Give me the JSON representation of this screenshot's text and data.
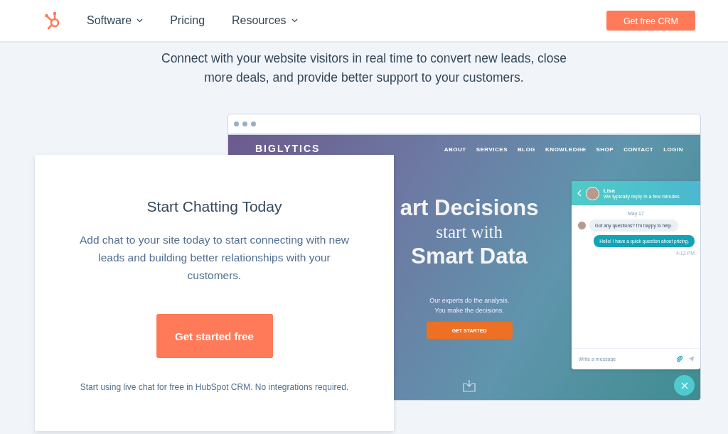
{
  "header": {
    "nav": [
      {
        "label": "Software",
        "dropdown": true
      },
      {
        "label": "Pricing",
        "dropdown": false
      },
      {
        "label": "Resources",
        "dropdown": true
      }
    ],
    "cta": "Get free CRM"
  },
  "intro": "Connect with your website visitors in real time to convert new leads, close more deals, and provide better support to your customers.",
  "mockup": {
    "site": {
      "logo": "BIGLYTICS",
      "nav": [
        "ABOUT",
        "SERVICES",
        "BLOG",
        "KNOWLEDGE",
        "SHOP",
        "CONTACT",
        "LOGIN"
      ],
      "headline": [
        "art Decisions",
        "start with",
        "Smart Data"
      ],
      "tagline": [
        "Our experts do the analysis.",
        "You make the decisions."
      ],
      "button": "GET STARTED"
    },
    "chat": {
      "agent": "Lisa",
      "status": "We typically reply in a few minutes",
      "date": "May 17",
      "messages": [
        {
          "kind": "incoming",
          "text": "Got any questions? I'm happy to help."
        },
        {
          "kind": "outgoing",
          "text": "Hello! I have a quick question about pricing."
        }
      ],
      "time": "4:12 PM",
      "placeholder": "Write a message"
    }
  },
  "card": {
    "title": "Start Chatting Today",
    "body": "Add chat to your site today to start connecting with new leads and building better relationships with your customers.",
    "button": "Get started free",
    "footnote": "Start using live chat for free in HubSpot CRM. No integrations required."
  }
}
